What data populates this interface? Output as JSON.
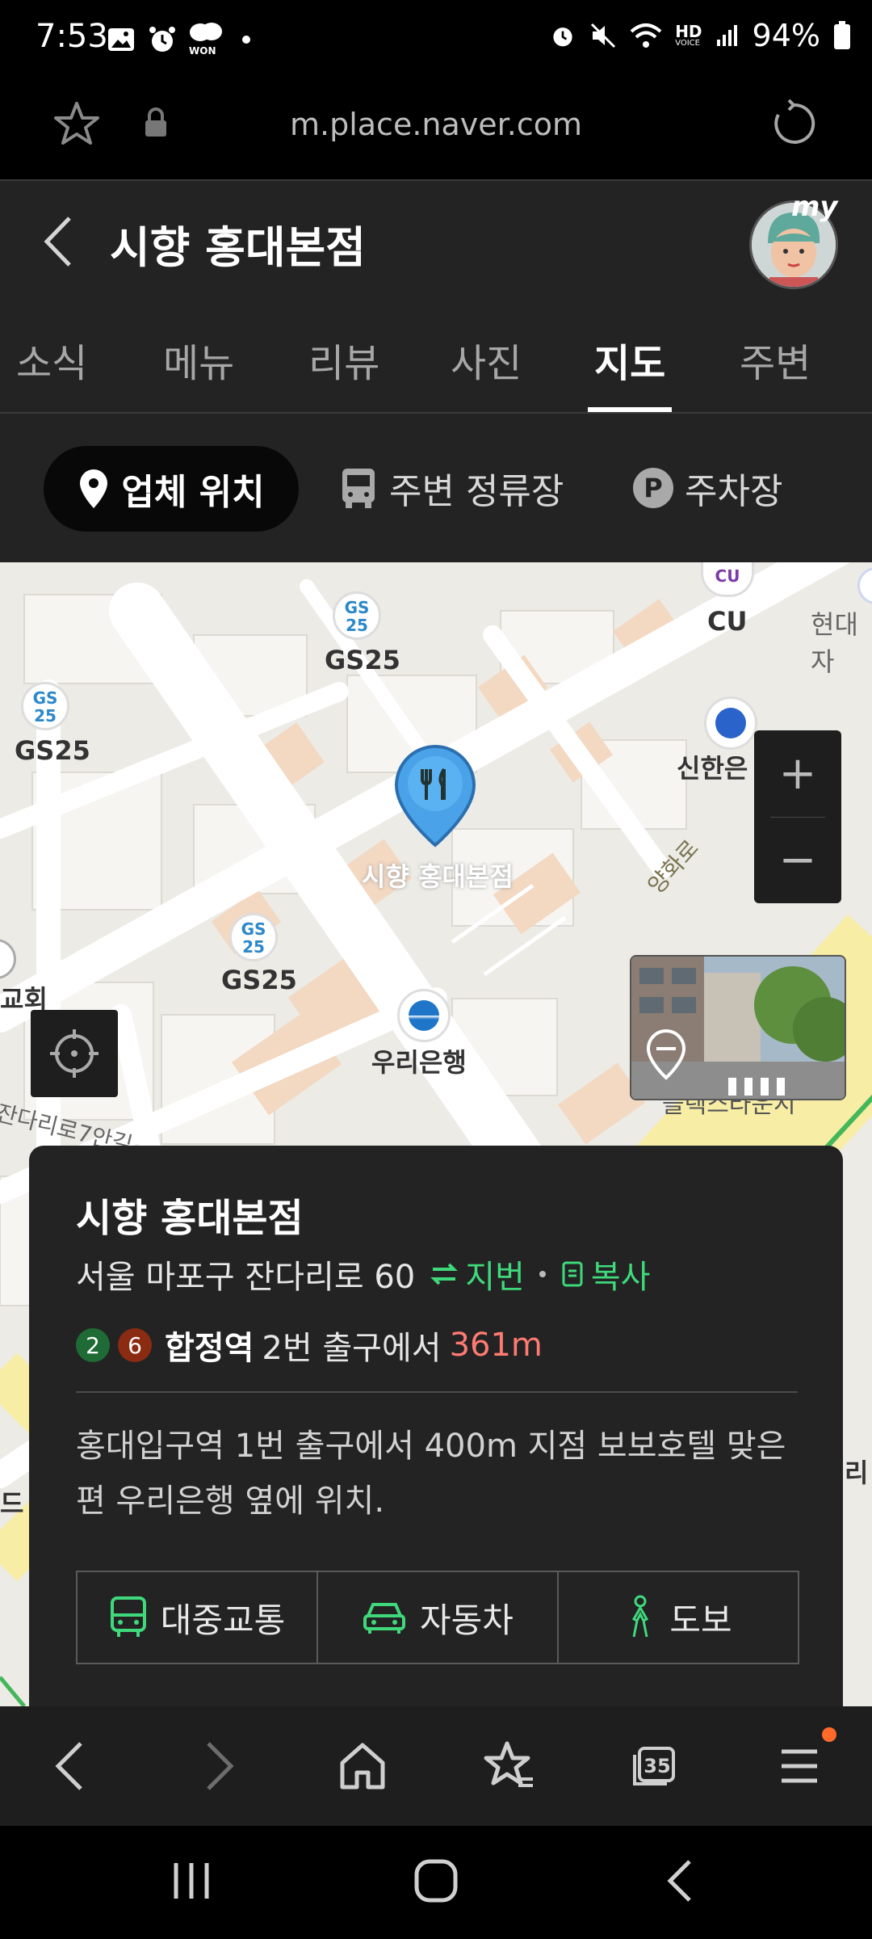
{
  "status": {
    "time": "7:53",
    "battery": "94%",
    "hd_label": "HD",
    "voice_label": "VOICE",
    "won_label": "WON"
  },
  "browser": {
    "url": "m.place.naver.com"
  },
  "place": {
    "title": "시향 홍대본점",
    "avatar_label": "my"
  },
  "tabs": [
    {
      "label": "소식"
    },
    {
      "label": "메뉴"
    },
    {
      "label": "리뷰"
    },
    {
      "label": "사진"
    },
    {
      "label": "지도"
    },
    {
      "label": "주변"
    }
  ],
  "filters": {
    "location": "업체 위치",
    "bus_stop": "주변 정류장",
    "parking": "주차장",
    "parking_icon": "P"
  },
  "map": {
    "poi": {
      "gs25_a": "GS25",
      "gs25_b": "GS25",
      "gs25_c": "GS25",
      "gs25_badge_top": "GS",
      "gs25_badge_bottom": "25",
      "cu": "CU",
      "cu_badge": "CU",
      "hyundai": "현대자",
      "shinhan": "신한은",
      "woori": "우리은행",
      "place_marker": "시향 홍대본점",
      "church": "교회",
      "road_yanghwa": "양화로",
      "road_jandari": "잔다리로7안길",
      "bottom_right": "블렉스타운시",
      "edge_right": "리",
      "edge_left": "드"
    },
    "zoom_in": "+",
    "zoom_out": "−"
  },
  "card": {
    "title": "시향 홍대본점",
    "address": "서울 마포구 잔다리로 60",
    "jibun": "지번",
    "copy": "복사",
    "line_2": "2",
    "line_6": "6",
    "station": "합정역",
    "exit_text": "2번 출구에서",
    "distance": "361m",
    "description": "홍대입구역 1번 출구에서 400m 지점 보보호텔 맞은편 우리은행 옆에 위치.",
    "btn_transit": "대중교통",
    "btn_car": "자동차",
    "btn_walk": "도보"
  },
  "browser_nav": {
    "tabs_count": "35"
  },
  "colors": {
    "accent_green": "#3fd97c",
    "distance_red": "#ff7b72",
    "line2": "#1f6b35",
    "line6": "#8a2b12"
  }
}
